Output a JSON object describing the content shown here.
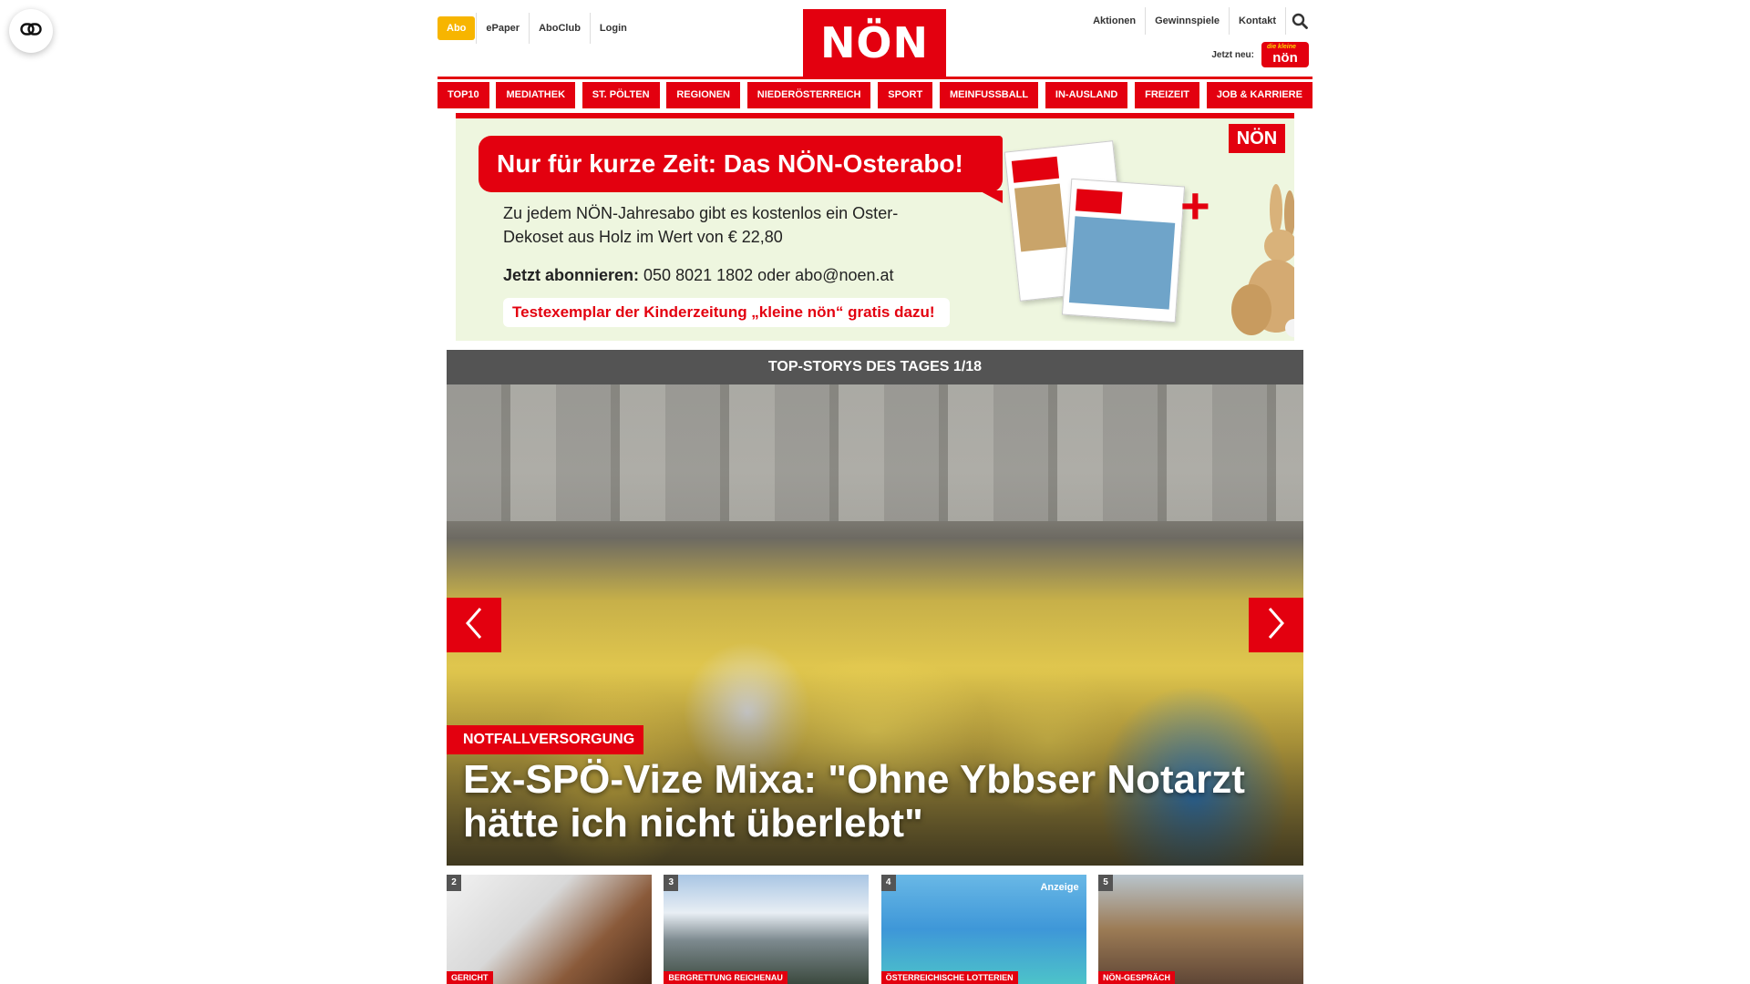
{
  "floating_button": {
    "icon": "link-icon"
  },
  "header": {
    "left_links": {
      "abo": "Abo",
      "epaper": "ePaper",
      "aboclub": "AboClub",
      "login": "Login"
    },
    "logo_text": "NÖN",
    "right_links": {
      "aktionen": "Aktionen",
      "gewinnspiele": "Gewinnspiele",
      "kontakt": "Kontakt"
    },
    "search_icon": "search-icon",
    "jetzt_neu": {
      "label": "Jetzt neu:",
      "badge_top": "die kleine",
      "badge_main": "nön"
    }
  },
  "nav": {
    "items": [
      "TOP10",
      "MEDIATHEK",
      "ST. PÖLTEN",
      "REGIONEN",
      "NIEDERÖSTERREICH",
      "SPORT",
      "MEINFUSSBALL",
      "IN-AUSLAND",
      "FREIZEIT",
      "JOB & KARRIERE"
    ]
  },
  "ad": {
    "headline": "Nur für kurze Zeit: Das NÖN-Osterabo!",
    "body_line1": "Zu jedem NÖN-Jahresabo gibt es kostenlos ein Oster-Dekoset aus Holz im Wert von € 22,80",
    "subscribe_label": "Jetzt abonnieren:",
    "subscribe_contact": " 050 8021 1802 oder abo@noen.at",
    "strip": "Testexemplar der Kinderzeitung „kleine nön“ gratis dazu!",
    "logo": "NÖN",
    "plus": "+",
    "accent": "#e3000f",
    "background": "#eef6df"
  },
  "stories": {
    "bar_title": "TOP-STORYS DES TAGES 1/18",
    "hero": {
      "category": "NOTFALLVERSORGUNG",
      "title": "Ex-SPÖ-Vize Mixa: \"Ohne Ybbser Notarzt hätte ich nicht überlebt\""
    },
    "prev_icon": "chevron-left-icon",
    "next_icon": "chevron-right-icon"
  },
  "thumbnails": [
    {
      "num": "2",
      "category": "GERICHT",
      "label": ""
    },
    {
      "num": "3",
      "category": "BERGRETTUNG REICHENAU",
      "label": ""
    },
    {
      "num": "4",
      "category": "ÖSTERREICHISCHE LOTTERIEN",
      "label": "Anzeige"
    },
    {
      "num": "5",
      "category": "NÖN-GESPRÄCH",
      "label": ""
    }
  ],
  "colors": {
    "brand_red": "#e3000f",
    "abo_yellow": "#f7b500",
    "bar_grey": "#545454"
  }
}
